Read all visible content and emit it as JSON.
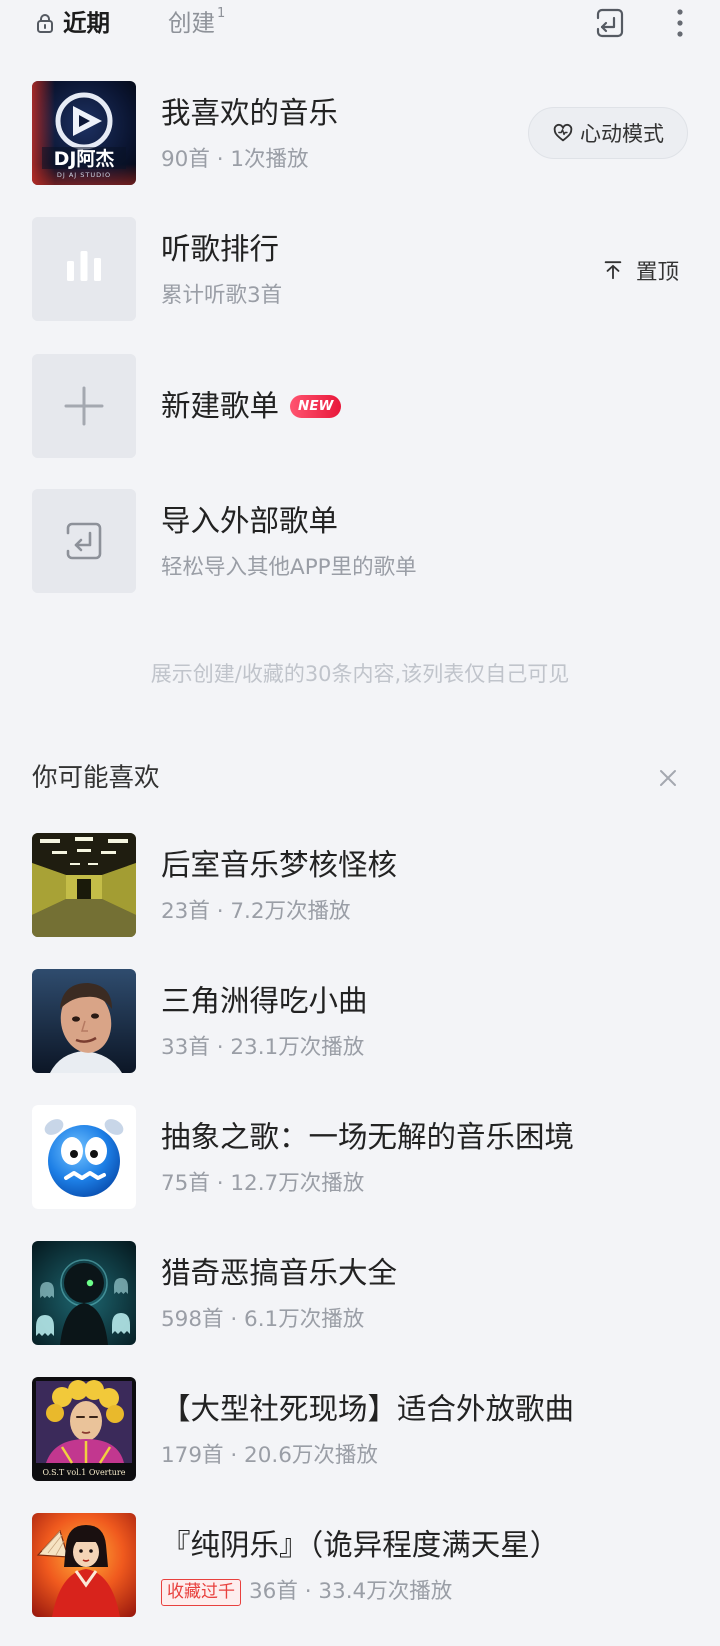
{
  "top_bar": {
    "tabs": [
      {
        "label": "近期",
        "icon": "lock-icon",
        "active": true
      },
      {
        "label": "创建",
        "count": "1",
        "active": false
      }
    ],
    "import_icon": "import-icon",
    "more_icon": "more-vertical-icon"
  },
  "my_playlists": [
    {
      "title": "我喜欢的音乐",
      "meta": "90首 · 1次播放",
      "cover_text": "DJ阿杰",
      "cover_subtext": "DJ AJ STUDIO",
      "action": {
        "label": "心动模式",
        "icon": "heart-pulse-icon"
      }
    },
    {
      "title": "听歌排行",
      "meta": "累计听歌3首",
      "cover_icon": "bar-chart-icon",
      "action": {
        "label": "置顶",
        "icon": "pin-top-icon"
      }
    },
    {
      "title": "新建歌单",
      "badge": "NEW",
      "cover_icon": "plus-icon"
    },
    {
      "title": "导入外部歌单",
      "meta": "轻松导入其他APP里的歌单",
      "cover_icon": "import-icon"
    }
  ],
  "notice": "展示创建/收藏的30条内容,该列表仅自己可见",
  "recommend": {
    "title": "你可能喜欢",
    "close_icon": "close-icon",
    "items": [
      {
        "title": "后室音乐梦核怪核",
        "meta": "23首 · 7.2万次播放"
      },
      {
        "title": "三角洲得吃小曲",
        "meta": "33首 · 23.1万次播放"
      },
      {
        "title": "抽象之歌：一场无解的音乐困境",
        "meta": "75首 · 12.7万次播放"
      },
      {
        "title": "猎奇恶搞音乐大全",
        "meta": "598首 · 6.1万次播放"
      },
      {
        "title": "【大型社死现场】适合外放歌曲",
        "meta": "179首 · 20.6万次播放",
        "cover_text": "O.S.T vol.1 Overture"
      },
      {
        "title": "『纯阴乐』（诡异程度满天星）",
        "badge": "收藏过千",
        "meta": "36首 · 33.4万次播放"
      }
    ]
  },
  "colors": {
    "background": "#f3f4f7",
    "tile_grey": "#e6e8ed",
    "title_text": "#222222",
    "meta_text": "#9a9ea6",
    "accent_red": "#e8413e"
  }
}
